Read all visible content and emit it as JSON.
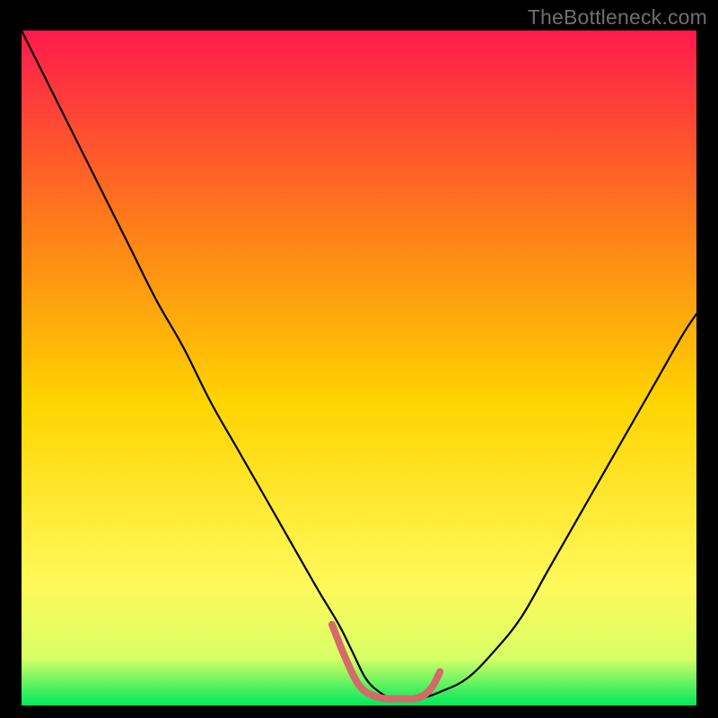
{
  "watermark": "TheBottleneck.com",
  "chart_data": {
    "type": "line",
    "title": "",
    "xlabel": "",
    "ylabel": "",
    "xlim": [
      0,
      100
    ],
    "ylim": [
      0,
      100
    ],
    "grid": false,
    "legend": false,
    "background_gradient": {
      "top": "#ff1a4d",
      "mid_upper": "#ff7a1a",
      "mid": "#ffd400",
      "mid_lower": "#fff95a",
      "band": "#d7ff66",
      "bottom": "#00e85c"
    },
    "series": [
      {
        "name": "bottleneck-curve",
        "color": "#000000",
        "x": [
          0,
          4,
          8,
          12,
          16,
          20,
          24,
          28,
          32,
          36,
          40,
          44,
          47,
          49,
          51,
          53,
          55,
          57,
          59,
          62,
          66,
          70,
          74,
          78,
          82,
          86,
          90,
          94,
          98,
          100
        ],
        "y": [
          100,
          92,
          84,
          76,
          68,
          60,
          53,
          45,
          38,
          31,
          24,
          17,
          12,
          8,
          4,
          2,
          1,
          1,
          1,
          2,
          4,
          8,
          13,
          20,
          27,
          34,
          41,
          48,
          55,
          58
        ]
      },
      {
        "name": "optimal-segment",
        "color": "#d46a6a",
        "stroke_width": 8,
        "stroke_linecap": "round",
        "x": [
          46,
          48,
          50,
          52,
          54,
          55,
          56,
          57,
          58,
          59,
          60,
          61,
          62
        ],
        "y": [
          12,
          7,
          3,
          1.5,
          1,
          1,
          1,
          1,
          1,
          1.2,
          1.8,
          3,
          5
        ]
      }
    ]
  }
}
